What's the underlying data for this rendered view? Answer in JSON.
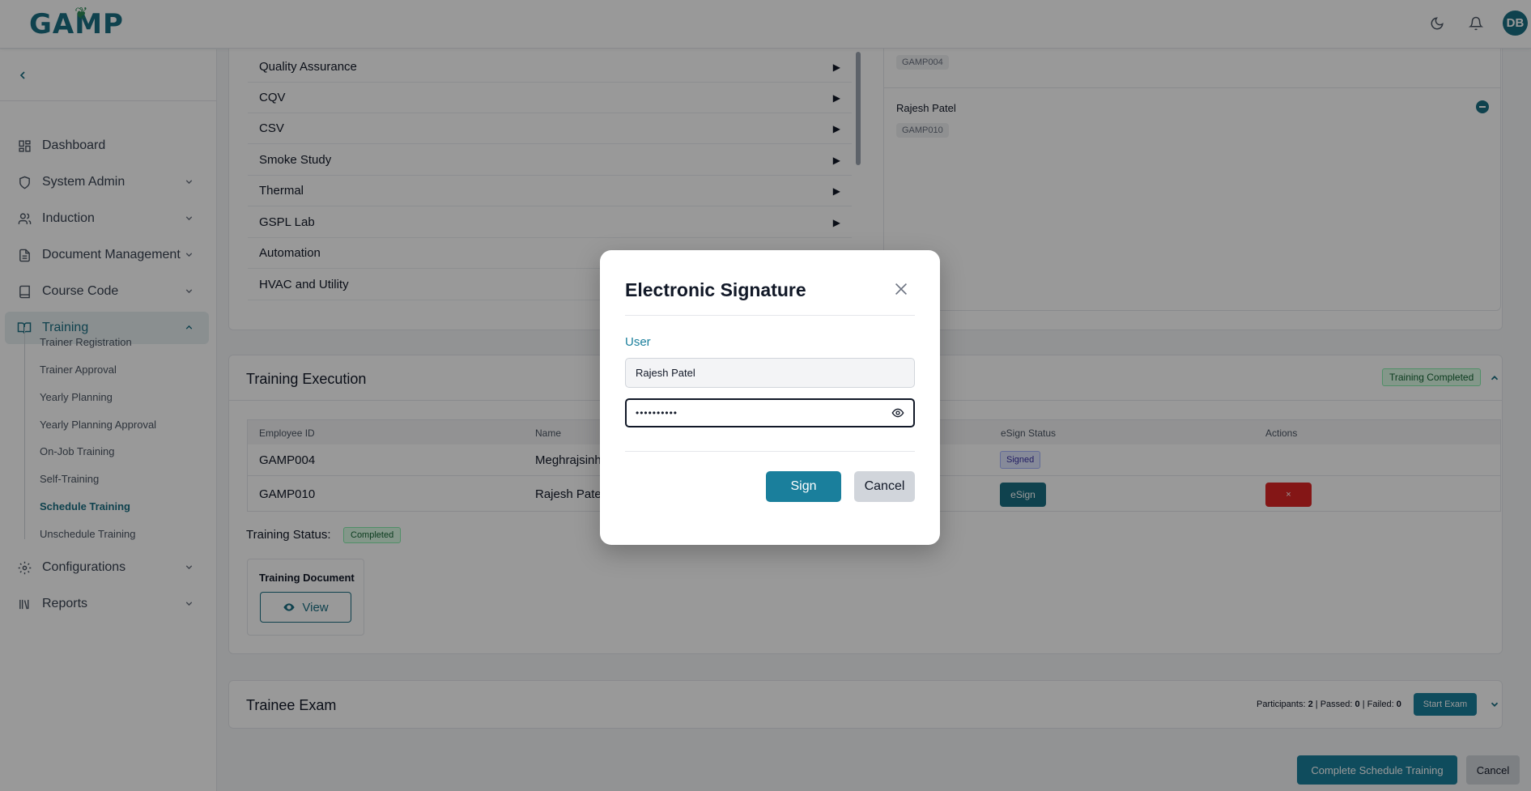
{
  "header": {
    "logo": "GAMP",
    "avatar_initials": "DB",
    "icons": [
      "moon-icon",
      "bell-icon"
    ]
  },
  "sidebar": {
    "items": [
      {
        "label": "Dashboard",
        "icon": "dashboard-icon"
      },
      {
        "label": "System Admin",
        "icon": "shield-icon"
      },
      {
        "label": "Induction",
        "icon": "users-icon"
      },
      {
        "label": "Document Management",
        "icon": "document-icon"
      },
      {
        "label": "Course Code",
        "icon": "book-icon"
      },
      {
        "label": "Training",
        "icon": "open-book-icon"
      },
      {
        "label": "Configurations",
        "icon": "gear-icon"
      },
      {
        "label": "Reports",
        "icon": "library-icon"
      }
    ],
    "training_sub": [
      "Trainer Registration",
      "Trainer Approval",
      "Yearly Planning",
      "Yearly Planning Approval",
      "On-Job Training",
      "Self-Training",
      "Schedule Training",
      "Unschedule Training"
    ],
    "active_sub": "Schedule Training"
  },
  "departments": [
    "Quality Assurance",
    "CQV",
    "CSV",
    "Smoke Study",
    "Thermal",
    "GSPL Lab",
    "Automation",
    "HVAC and Utility"
  ],
  "selected_panel": {
    "top_tag": "GAMP004",
    "employee_name": "Rajesh Patel",
    "employee_tag": "GAMP010"
  },
  "training_execution": {
    "title": "Training Execution",
    "status_badge": "Training Completed",
    "columns": [
      "Employee ID",
      "Name",
      "eSign Status",
      "Actions"
    ],
    "rows": [
      {
        "id": "GAMP004",
        "name": "Meghrajsinh",
        "esign": "Signed"
      },
      {
        "id": "GAMP010",
        "name": "Rajesh Patel",
        "esign": "eSign",
        "action": "×"
      }
    ],
    "status_label": "Training Status:",
    "status_value": "Completed",
    "doc_title": "Training Document",
    "view_label": "View"
  },
  "trainee_exam": {
    "title": "Trainee Exam",
    "participants_label": "Participants:",
    "participants": "2",
    "passed_label": "Passed:",
    "passed": "0",
    "failed_label": "Failed:",
    "failed": "0",
    "start_exam": "Start Exam"
  },
  "footer": {
    "complete_label": "Complete Schedule Training",
    "cancel_label": "Cancel"
  },
  "modal": {
    "title": "Electronic Signature",
    "user_label": "User",
    "user_value": "Rajesh Patel",
    "password_mask": "••••••••••",
    "sign_label": "Sign",
    "cancel_label": "Cancel"
  },
  "colors": {
    "accent": "#1a7f9c",
    "brand": "#1a6e82",
    "danger": "#dc2626",
    "success_bg": "#dcfce7"
  }
}
